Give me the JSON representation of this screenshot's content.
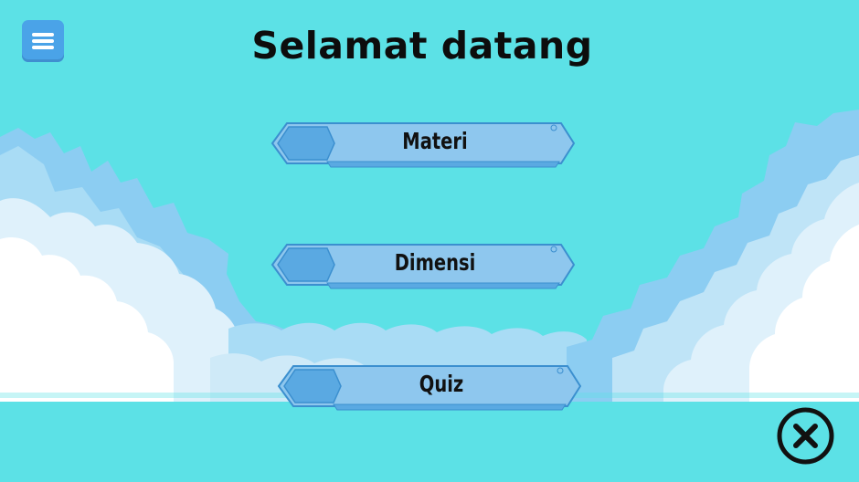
{
  "screen": {
    "title": "Selamat datang"
  },
  "menu": {
    "buttons": [
      {
        "label": "Materi"
      },
      {
        "label": "Dimensi"
      },
      {
        "label": "Quiz"
      }
    ]
  },
  "icons": {
    "menu": "hamburger-icon",
    "close": "close-circle-icon"
  },
  "colors": {
    "background": "#5ce1e6",
    "button_fill": "#8ec7ee",
    "button_border": "#3b8fcf",
    "hex_accent": "#5aa9e2",
    "menu_button": "#4aa3e8"
  }
}
